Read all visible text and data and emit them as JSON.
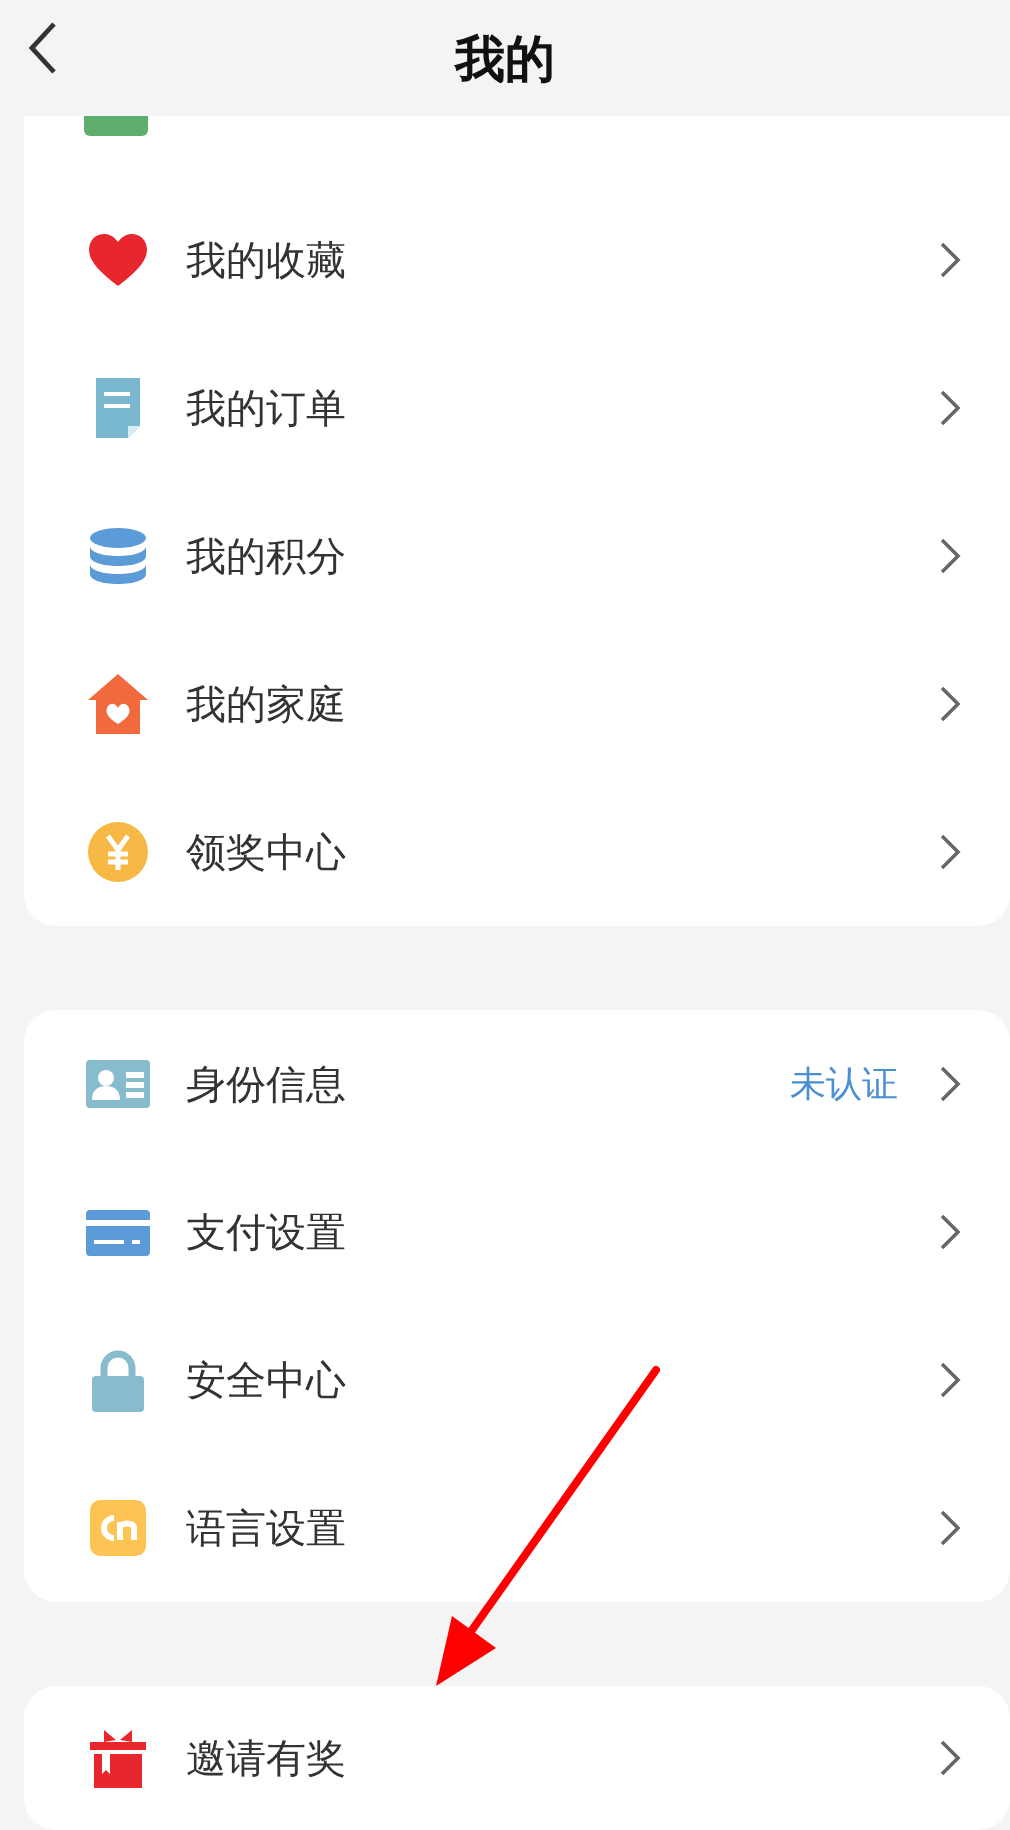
{
  "header": {
    "title": "我的"
  },
  "groups": [
    {
      "rows": [
        {
          "label": "我的收藏"
        },
        {
          "label": "我的订单"
        },
        {
          "label": "我的积分"
        },
        {
          "label": "我的家庭"
        },
        {
          "label": "领奖中心"
        }
      ]
    },
    {
      "rows": [
        {
          "label": "身份信息",
          "status": "未认证"
        },
        {
          "label": "支付设置"
        },
        {
          "label": "安全中心"
        },
        {
          "label": "语言设置"
        }
      ]
    },
    {
      "rows": [
        {
          "label": "邀请有奖"
        }
      ]
    }
  ]
}
